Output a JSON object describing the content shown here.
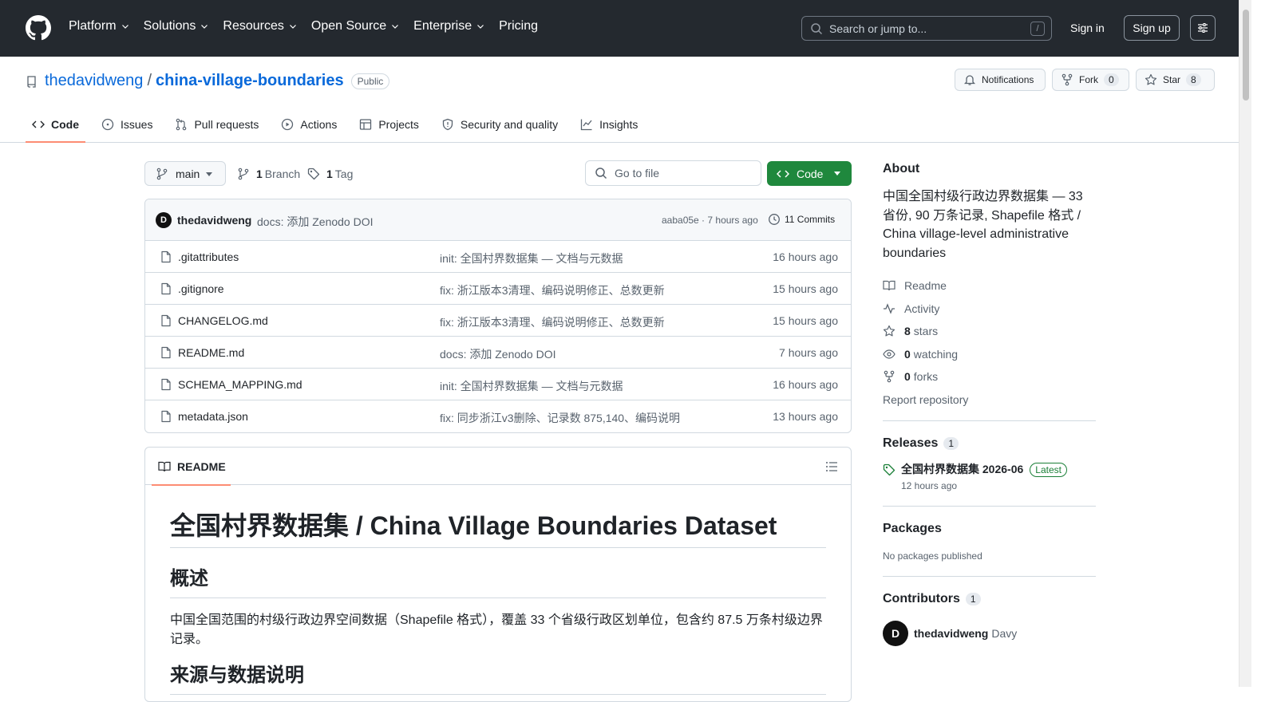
{
  "header": {
    "nav": [
      "Platform",
      "Solutions",
      "Resources",
      "Open Source",
      "Enterprise",
      "Pricing"
    ],
    "search_placeholder": "Search or jump to...",
    "search_shortcut": "/",
    "signin": "Sign in",
    "signup": "Sign up"
  },
  "repo": {
    "owner": "thedavidweng",
    "separator": "/",
    "name": "china-village-boundaries",
    "visibility": "Public",
    "notifications": "Notifications",
    "fork_label": "Fork",
    "fork_count": "0",
    "star_label": "Star",
    "star_count": "8"
  },
  "tabs": [
    "Code",
    "Issues",
    "Pull requests",
    "Actions",
    "Projects",
    "Security and quality",
    "Insights"
  ],
  "toolbar": {
    "branch": "main",
    "branch_count": "1",
    "branch_label": "Branch",
    "tag_count": "1",
    "tag_label": "Tag",
    "goto_placeholder": "Go to file",
    "code_button": "Code"
  },
  "commit": {
    "avatar": "D",
    "author": "thedavidweng",
    "message": "docs: 添加 Zenodo DOI",
    "hash_time": "aaba05e · 7 hours ago",
    "commits": "11 Commits"
  },
  "files": [
    {
      "name": ".gitattributes",
      "message": "init: 全国村界数据集 — 文档与元数据",
      "time": "16 hours ago"
    },
    {
      "name": ".gitignore",
      "message": "fix: 浙江版本3清理、编码说明修正、总数更新",
      "time": "15 hours ago"
    },
    {
      "name": "CHANGELOG.md",
      "message": "fix: 浙江版本3清理、编码说明修正、总数更新",
      "time": "15 hours ago"
    },
    {
      "name": "README.md",
      "message": "docs: 添加 Zenodo DOI",
      "time": "7 hours ago"
    },
    {
      "name": "SCHEMA_MAPPING.md",
      "message": "init: 全国村界数据集 — 文档与元数据",
      "time": "16 hours ago"
    },
    {
      "name": "metadata.json",
      "message": "fix: 同步浙江v3删除、记录数 875,140、编码说明",
      "time": "13 hours ago"
    }
  ],
  "readme": {
    "tab": "README",
    "h1": "全国村界数据集 / China Village Boundaries Dataset",
    "h2": "概述",
    "p": "中国全国范围的村级行政边界空间数据（Shapefile 格式），覆盖 33 个省级行政区划单位，包含约 87.5 万条村级边界记录。",
    "h2b": "来源与数据说明"
  },
  "about": {
    "title": "About",
    "description": "中国全国村级行政边界数据集 — 33 省份, 90 万条记录, Shapefile 格式 / China village-level administrative boundaries",
    "readme": "Readme",
    "activity": "Activity",
    "stars_count": "8",
    "stars_label": "stars",
    "watching_count": "0",
    "watching_label": "watching",
    "forks_count": "0",
    "forks_label": "forks",
    "report": "Report repository"
  },
  "releases": {
    "title": "Releases",
    "count": "1",
    "name": "全国村界数据集 2026-06",
    "badge": "Latest",
    "when": "12 hours ago"
  },
  "packages": {
    "title": "Packages",
    "empty": "No packages published"
  },
  "contributors": {
    "title": "Contributors",
    "count": "1",
    "avatar": "D",
    "user": "thedavidweng",
    "name": "Davy"
  }
}
